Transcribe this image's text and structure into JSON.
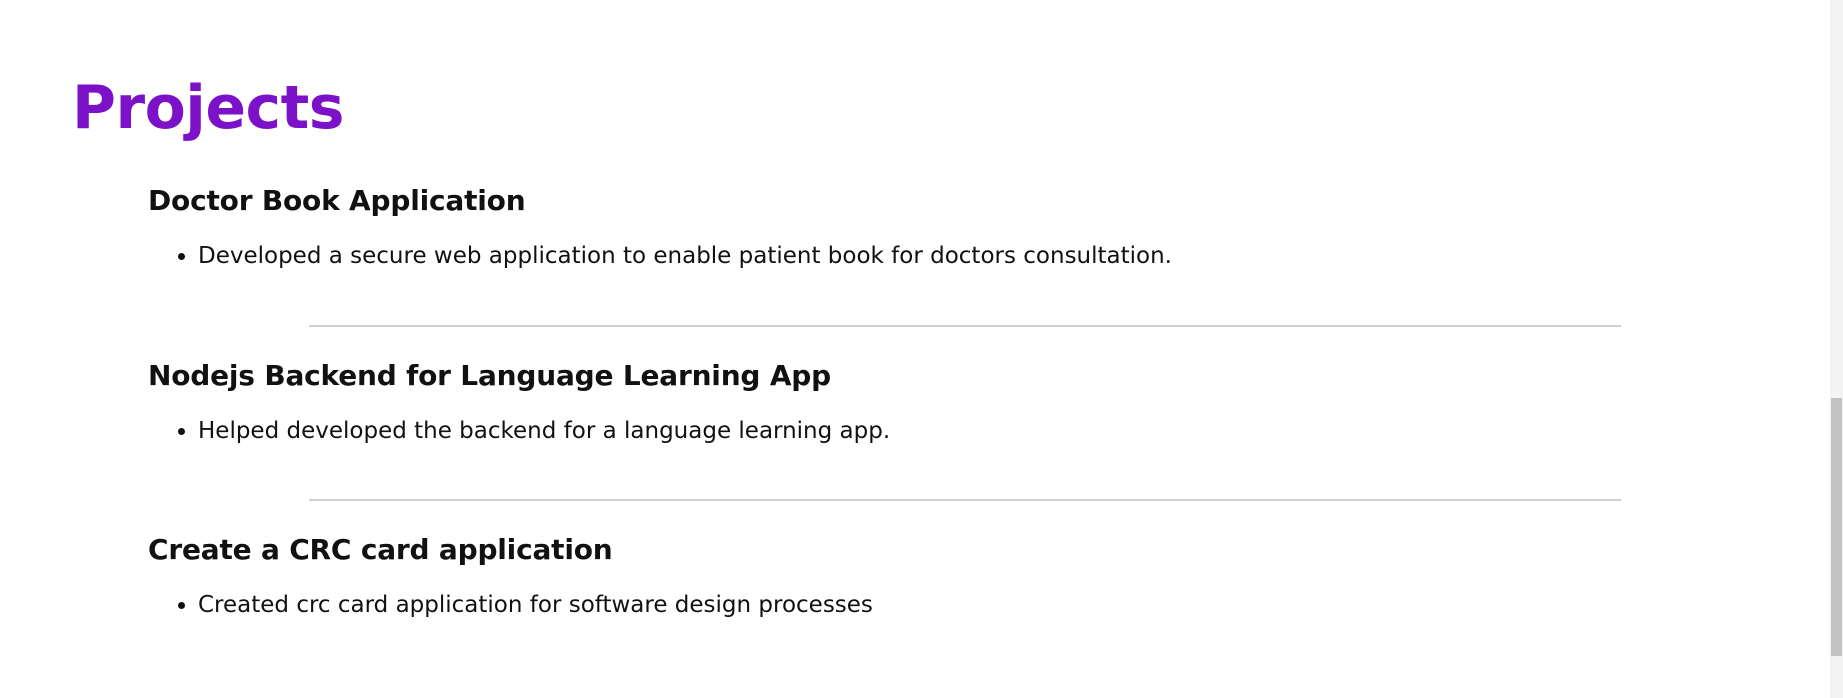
{
  "section": {
    "title": "Projects"
  },
  "projects": [
    {
      "title": "Doctor Book Application",
      "bullets": [
        "Developed a secure web application to enable patient book for doctors consultation."
      ]
    },
    {
      "title": "Nodejs Backend for Language Learning App",
      "bullets": [
        "Helped developed the backend for a language learning app."
      ]
    },
    {
      "title": "Create a CRC card application",
      "bullets": [
        "Created crc card application for software design processes"
      ]
    }
  ],
  "colors": {
    "accent": "#7b11c9",
    "text": "#111111",
    "divider": "#cfcfcf"
  }
}
